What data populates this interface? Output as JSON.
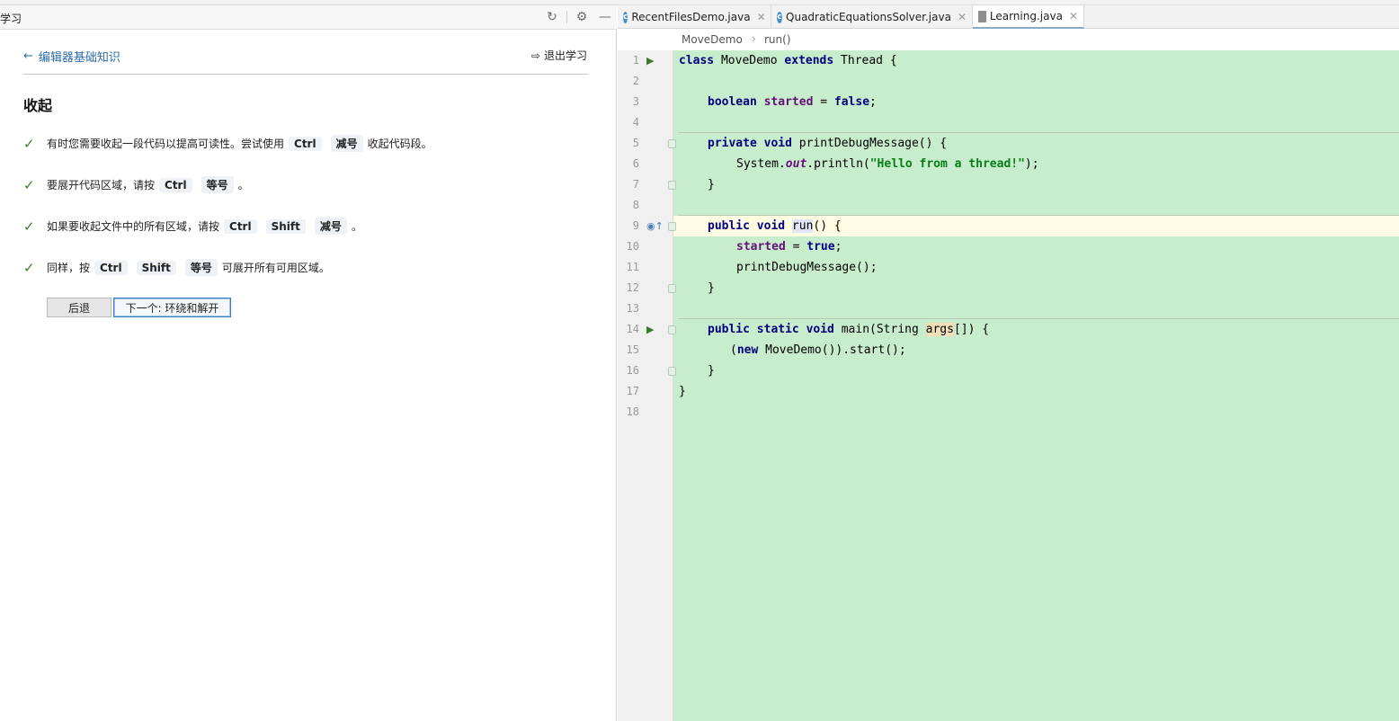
{
  "left_panel": {
    "title": "学习",
    "header_icons": [
      "restart-icon",
      "gear-icon",
      "minimize-icon"
    ],
    "back_link": "编辑器基础知识",
    "exit_link": "退出学习",
    "lesson_title": "收起",
    "steps": [
      {
        "parts": [
          "有时您需要收起一段代码以提高可读性。尝试使用",
          "Ctrl",
          "减号",
          "收起代码段。"
        ]
      },
      {
        "parts": [
          "要展开代码区域，请按",
          "Ctrl",
          "等号",
          "。"
        ]
      },
      {
        "parts": [
          "如果要收起文件中的所有区域，请按",
          "Ctrl",
          "Shift",
          "减号",
          "。"
        ]
      },
      {
        "parts": [
          "同样，按",
          "Ctrl",
          "Shift",
          "等号",
          "可展开所有可用区域。"
        ]
      }
    ],
    "back_button": "后退",
    "next_button": "下一个: 环绕和解开"
  },
  "editor": {
    "tabs": [
      {
        "label": "RecentFilesDemo.java",
        "icon": "java-class-icon"
      },
      {
        "label": "QuadraticEquationsSolver.java",
        "icon": "java-class-icon"
      },
      {
        "label": "Learning.java",
        "icon": "java-file-icon",
        "active": true
      }
    ],
    "breadcrumb": [
      "MoveDemo",
      "run()"
    ],
    "lines": [
      {
        "n": "1"
      },
      {
        "n": "2"
      },
      {
        "n": "3"
      },
      {
        "n": "4"
      },
      {
        "n": "5"
      },
      {
        "n": "6"
      },
      {
        "n": "7"
      },
      {
        "n": "8"
      },
      {
        "n": "9"
      },
      {
        "n": "10"
      },
      {
        "n": "11"
      },
      {
        "n": "12"
      },
      {
        "n": "13"
      },
      {
        "n": "14"
      },
      {
        "n": "15"
      },
      {
        "n": "16"
      },
      {
        "n": "17"
      },
      {
        "n": "18"
      }
    ],
    "code": {
      "l1_kw1": "class",
      "l1_t1": " MoveDemo ",
      "l1_kw2": "extends",
      "l1_t2": " Thread {",
      "l3_kw": "boolean",
      "l3_fld": "started",
      "l3_t": " = ",
      "l3_kw2": "false",
      "l3_end": ";",
      "l5_kw": "private void",
      "l5_t": " printDebugMessage() {",
      "l6_t1": "System.",
      "l6_stat": "out",
      "l6_t2": ".println(",
      "l6_str": "\"Hello from a thread!\"",
      "l6_t3": ");",
      "l7_t": "}",
      "l9_kw": "public void",
      "l9_run": "run",
      "l9_t": "() {",
      "l10_fld": "started",
      "l10_t": " = ",
      "l10_kw": "true",
      "l10_end": ";",
      "l11_t": "printDebugMessage();",
      "l12_t": "}",
      "l14_kw": "public static void",
      "l14_t1": " main(String ",
      "l14_args": "args",
      "l14_t2": "[]) {",
      "l15_t1": "(",
      "l15_kw": "new",
      "l15_t2": " MoveDemo()).start();",
      "l16_t": "}",
      "l17_t": "}"
    }
  },
  "colors": {
    "code_bg": "#c8edcc",
    "caret_line": "#fdfbe1",
    "keyword": "#000080",
    "field": "#660e7a",
    "string": "#067d17",
    "link": "#2d6ea8",
    "check": "#3d7a2a"
  }
}
